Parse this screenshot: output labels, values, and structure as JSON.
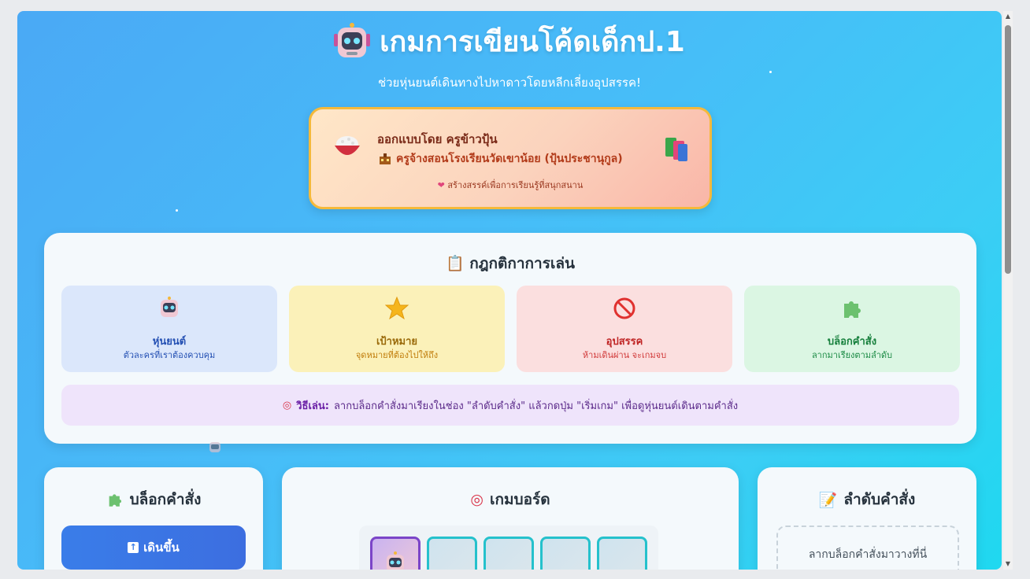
{
  "header": {
    "title": "เกมการเขียนโค้ดเด็กป.1",
    "subtitle": "ช่วยหุ่นยนต์เดินทางไปหาดาวโดยหลีกเลี่ยงอุปสรรค!"
  },
  "credit": {
    "designer": "ออกแบบโดย ครูข้าวปุ้น",
    "school": "ครูจ้างสอนโรงเรียนวัดเขาน้อย (ปุ้นประชานุกูล)",
    "tagline": "สร้างสรรค์เพื่อการเรียนรู้ที่สนุกสนาน"
  },
  "rules": {
    "title": "กฎกติกาการเล่น",
    "cards": [
      {
        "name": "หุ่นยนต์",
        "desc": "ตัวละครที่เราต้องควบคุม",
        "icon": "robot-icon",
        "bg": "#dbe7fb",
        "color": "#2450b3"
      },
      {
        "name": "เป้าหมาย",
        "desc": "จุดหมายที่ต้องไปให้ถึง",
        "icon": "star-icon",
        "bg": "#fbf1b9",
        "color": "#9a6a0a"
      },
      {
        "name": "อุปสรรค",
        "desc": "ห้ามเดินผ่าน จะเกมจบ",
        "icon": "prohibited-icon",
        "bg": "#fbdfdf",
        "color": "#c02626"
      },
      {
        "name": "บล็อกคำสั่ง",
        "desc": "ลากมาเรียงตามลำดับ",
        "icon": "puzzle-icon",
        "bg": "#dbf6e3",
        "color": "#17803d"
      }
    ],
    "how_label": "วิธีเล่น:",
    "how_text": "ลากบล็อกคำสั่งมาเรียงในช่อง \"ลำดับคำสั่ง\" แล้วกดปุ่ม \"เริ่มเกม\" เพื่อดูหุ่นยนต์เดินตามคำสั่ง"
  },
  "blocks_panel": {
    "title": "บล็อกคำสั่ง",
    "up_label": "เดินขึ้น"
  },
  "board_panel": {
    "title": "เกมบอร์ด"
  },
  "sequence_panel": {
    "title": "ลำดับคำสั่ง",
    "placeholder": "ลากบล็อกคำสั่งมาวางที่นี่"
  },
  "colors": {
    "accent": "#3c7be8",
    "bg_gradient_start": "#4aa9f5",
    "bg_gradient_end": "#1fd8f0"
  }
}
